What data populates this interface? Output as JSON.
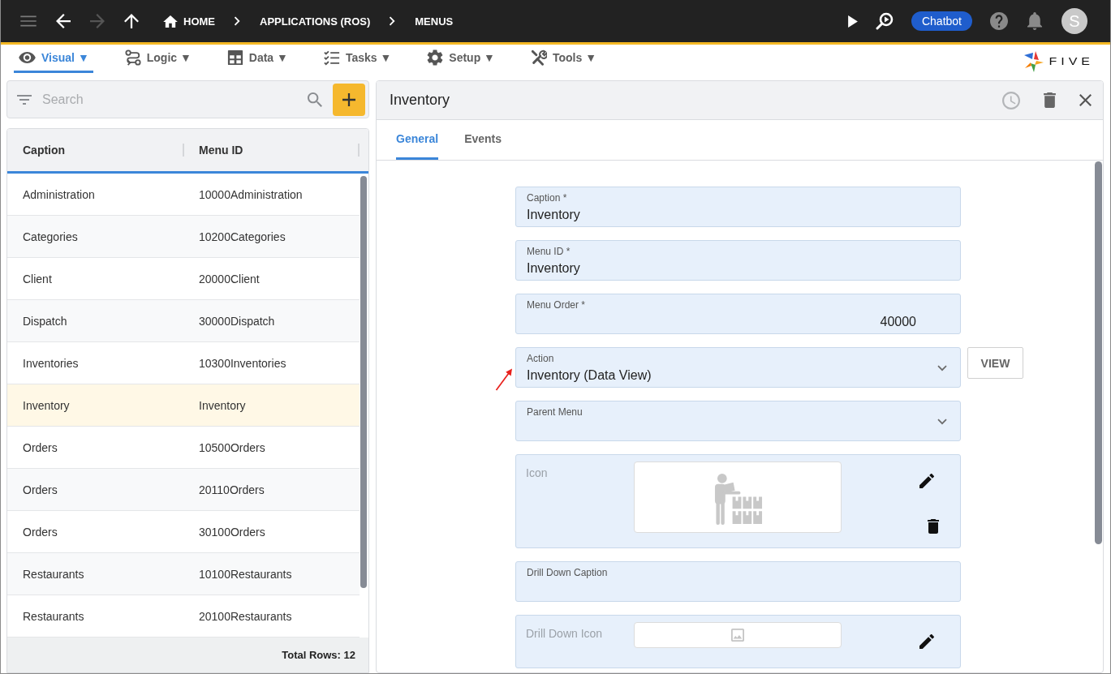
{
  "top_bar": {
    "nav_buttons": [
      {
        "kind": "back",
        "disabled": false
      },
      {
        "kind": "forward",
        "disabled": true
      },
      {
        "kind": "up",
        "disabled": false
      }
    ],
    "breadcrumbs": [
      {
        "kind": "home",
        "label": "HOME"
      },
      {
        "kind": "plain",
        "label": "APPLICATIONS (ROS)"
      },
      {
        "kind": "plain",
        "label": "MENUS"
      }
    ],
    "chatbot_button": "Chatbot",
    "avatar": "S"
  },
  "menu_tabs": [
    {
      "kind": "visual",
      "label": "Visual ▼",
      "selected": true
    },
    {
      "kind": "logic",
      "label": "Logic ▼",
      "selected": false
    },
    {
      "kind": "data",
      "label": "Data ▼",
      "selected": false
    },
    {
      "kind": "tasks",
      "label": "Tasks ▼",
      "selected": false
    },
    {
      "kind": "setup",
      "label": "Setup ▼",
      "selected": false
    },
    {
      "kind": "tools",
      "label": "Tools ▼",
      "selected": false
    }
  ],
  "logo": "FIVE",
  "list_panel": {
    "search": {
      "placeholder": "Search"
    },
    "columns": [
      "Caption",
      "Menu ID"
    ],
    "rows": [
      {
        "cells": [
          "Administration",
          "10000Administration"
        ],
        "selected": false
      },
      {
        "cells": [
          "Categories",
          "10200Categories"
        ],
        "selected": false
      },
      {
        "cells": [
          "Client",
          "20000Client"
        ],
        "selected": false
      },
      {
        "cells": [
          "Dispatch",
          "30000Dispatch"
        ],
        "selected": false
      },
      {
        "cells": [
          "Inventories",
          "10300Inventories"
        ],
        "selected": false
      },
      {
        "cells": [
          "Inventory",
          "Inventory"
        ],
        "selected": true
      },
      {
        "cells": [
          "Orders",
          "10500Orders"
        ],
        "selected": false
      },
      {
        "cells": [
          "Orders",
          "20110Orders"
        ],
        "selected": false
      },
      {
        "cells": [
          "Orders",
          "30100Orders"
        ],
        "selected": false
      },
      {
        "cells": [
          "Restaurants",
          "10100Restaurants"
        ],
        "selected": false
      },
      {
        "cells": [
          "Restaurants",
          "20100Restaurants"
        ],
        "selected": false
      }
    ],
    "footer": "Total Rows: 12"
  },
  "detail_panel": {
    "title": "Inventory",
    "tabs": [
      {
        "label": "General",
        "selected": true
      },
      {
        "label": "Events",
        "selected": false
      }
    ],
    "fields": [
      {
        "kind": "text",
        "label": "Caption *",
        "value": "Inventory"
      },
      {
        "kind": "text",
        "label": "Menu ID *",
        "value": "Inventory"
      },
      {
        "kind": "number",
        "label": "Menu Order *",
        "value": "40000"
      },
      {
        "kind": "select",
        "label": "Action",
        "value": "Inventory (Data View)",
        "button": "VIEW"
      },
      {
        "kind": "select",
        "label": "Parent Menu"
      },
      {
        "kind": "image",
        "label": "Icon",
        "has_image": true
      },
      {
        "kind": "text",
        "label": "Drill Down Caption"
      },
      {
        "kind": "image",
        "label": "Drill Down Icon",
        "has_image": false
      }
    ]
  }
}
